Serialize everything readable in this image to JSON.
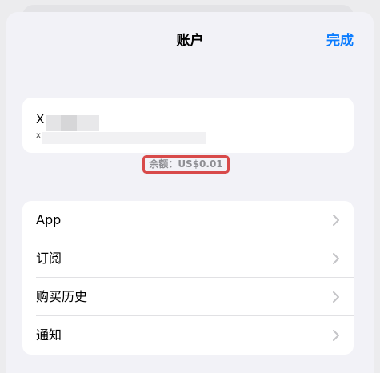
{
  "nav": {
    "title": "账户",
    "done_label": "完成"
  },
  "profile": {
    "name_initial": "X",
    "email_initial": "x"
  },
  "balance": {
    "text": "余额：US$0.01"
  },
  "menu": {
    "items": [
      {
        "label": "App"
      },
      {
        "label": "订阅"
      },
      {
        "label": "购买历史"
      },
      {
        "label": "通知"
      }
    ]
  },
  "colors": {
    "accent": "#0a7cff",
    "highlight": "#d84a4a",
    "background": "#f2f2f7"
  }
}
